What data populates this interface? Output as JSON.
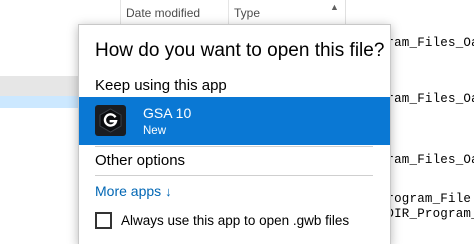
{
  "explorer": {
    "columns": {
      "date_modified": "Date modified",
      "type": "Type"
    },
    "right_lines": [
      "ogram_Files_Oa",
      "ogram_Files_Oa",
      "ogram_Files_Oa",
      "_Program_File",
      "ETDIR_Program_"
    ]
  },
  "dialog": {
    "title": "How do you want to open this file?",
    "keep_using_label": "Keep using this app",
    "app": {
      "name": "GSA 10",
      "tag": "New",
      "icon": "gsa-g-icon"
    },
    "other_options_label": "Other options",
    "more_apps_label": "More apps",
    "more_apps_arrow": "↓",
    "always_use_label": "Always use this app to open .gwb files",
    "always_use_checked": false
  },
  "colors": {
    "selection": "#0a78d4",
    "link": "#0066b4",
    "app_icon_bg": "#1a1d22"
  }
}
